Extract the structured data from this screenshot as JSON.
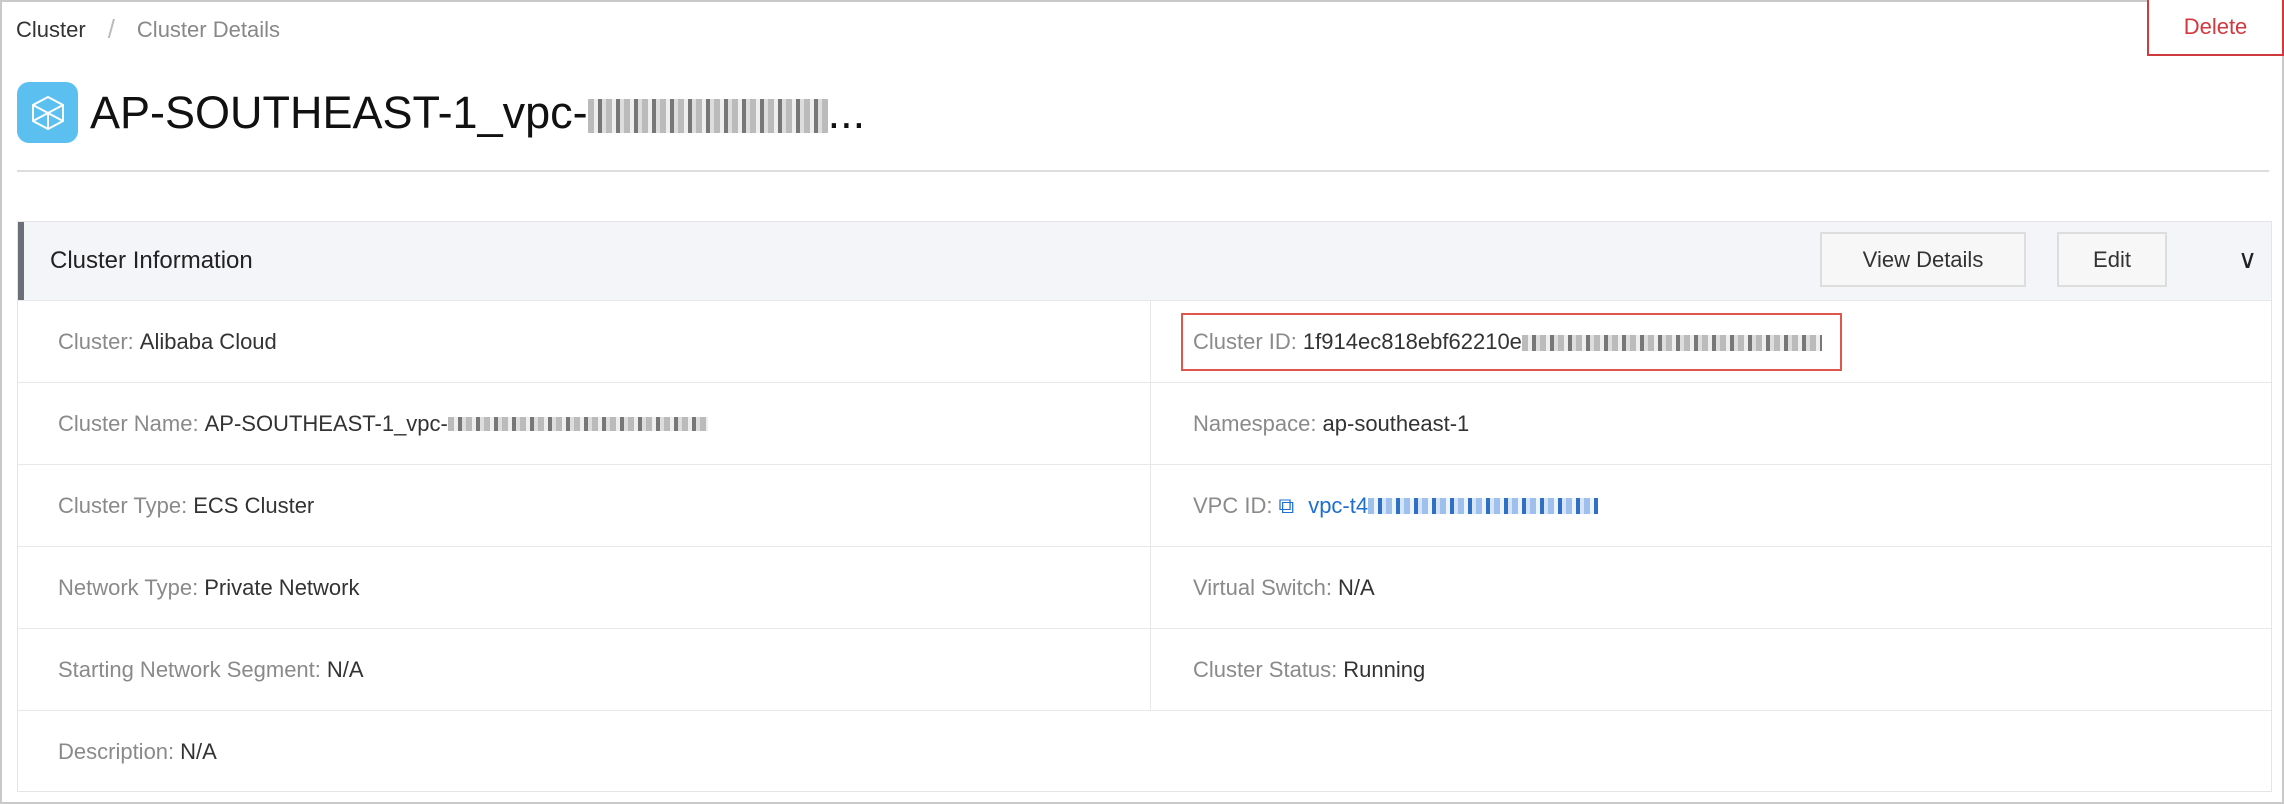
{
  "breadcrumb": {
    "root": "Cluster",
    "separator": "/",
    "current": "Cluster Details"
  },
  "delete_label": "Delete",
  "title": "AP-SOUTHEAST-1_vpc-",
  "panel": {
    "title": "Cluster Information",
    "view_details": "View Details",
    "edit": "Edit",
    "fields": [
      {
        "label": "Cluster:",
        "value": "Alibaba Cloud"
      },
      {
        "label": "Cluster ID:",
        "value": "1f914ec818ebf62210e"
      },
      {
        "label": "Cluster Name:",
        "value": "AP-SOUTHEAST-1_vpc-"
      },
      {
        "label": "Namespace:",
        "value": "ap-southeast-1"
      },
      {
        "label": "Cluster Type:",
        "value": "ECS Cluster"
      },
      {
        "label": "VPC ID:",
        "value": "vpc-t4"
      },
      {
        "label": "Network Type:",
        "value": "Private Network"
      },
      {
        "label": "Virtual Switch:",
        "value": "N/A"
      },
      {
        "label": "Starting Network Segment:",
        "value": "N/A"
      },
      {
        "label": "Cluster Status:",
        "value": "Running"
      },
      {
        "label": "Description:",
        "value": "N/A"
      }
    ]
  }
}
